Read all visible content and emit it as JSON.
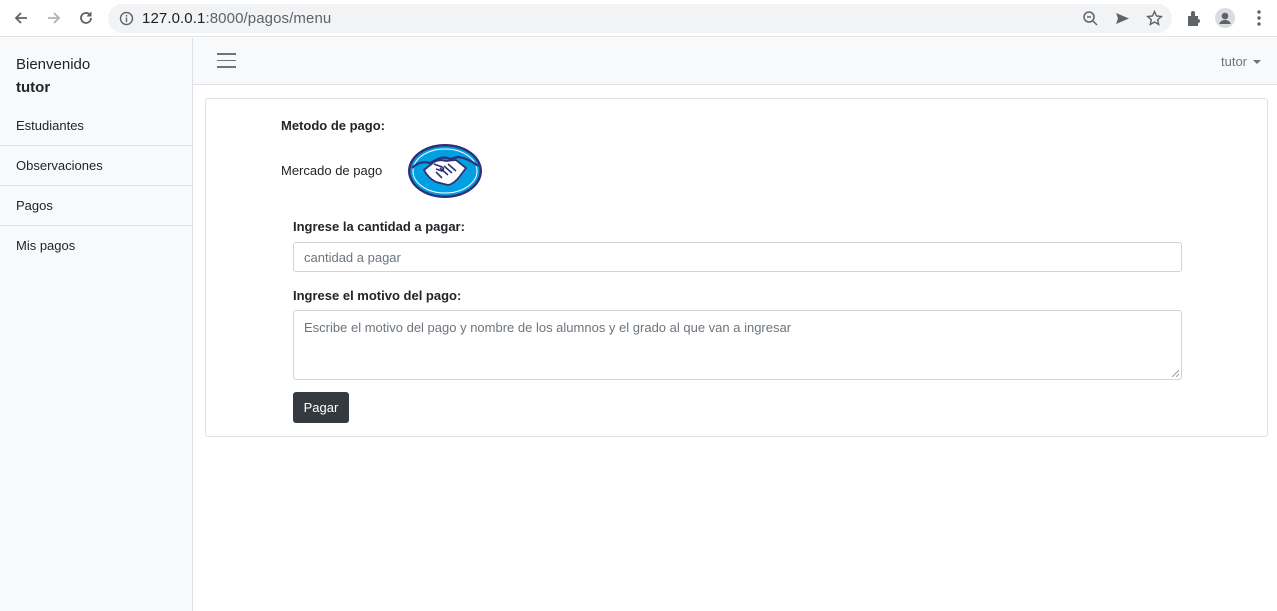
{
  "browser": {
    "url_host": "127.0.0.1",
    "url_path": ":8000/pagos/menu"
  },
  "sidebar": {
    "welcome": "Bienvenido",
    "username": "tutor",
    "items": [
      {
        "label": "Estudiantes"
      },
      {
        "label": "Observaciones"
      },
      {
        "label": "Pagos"
      },
      {
        "label": "Mis pagos"
      }
    ]
  },
  "topnav": {
    "user_label": "tutor"
  },
  "payment": {
    "method_heading": "Metodo de pago:",
    "method_name": "Mercado de pago",
    "amount_label": "Ingrese la cantidad a pagar:",
    "amount_placeholder": "cantidad a pagar",
    "reason_label": "Ingrese el motivo del pago:",
    "reason_placeholder": "Escribe el motivo del pago y nombre de los alumnos y el grado al que van a ingresar",
    "submit_label": "Pagar"
  },
  "colors": {
    "logo_blue": "#00a0e3",
    "logo_dark": "#2d3277",
    "button_dark": "#343a40"
  }
}
